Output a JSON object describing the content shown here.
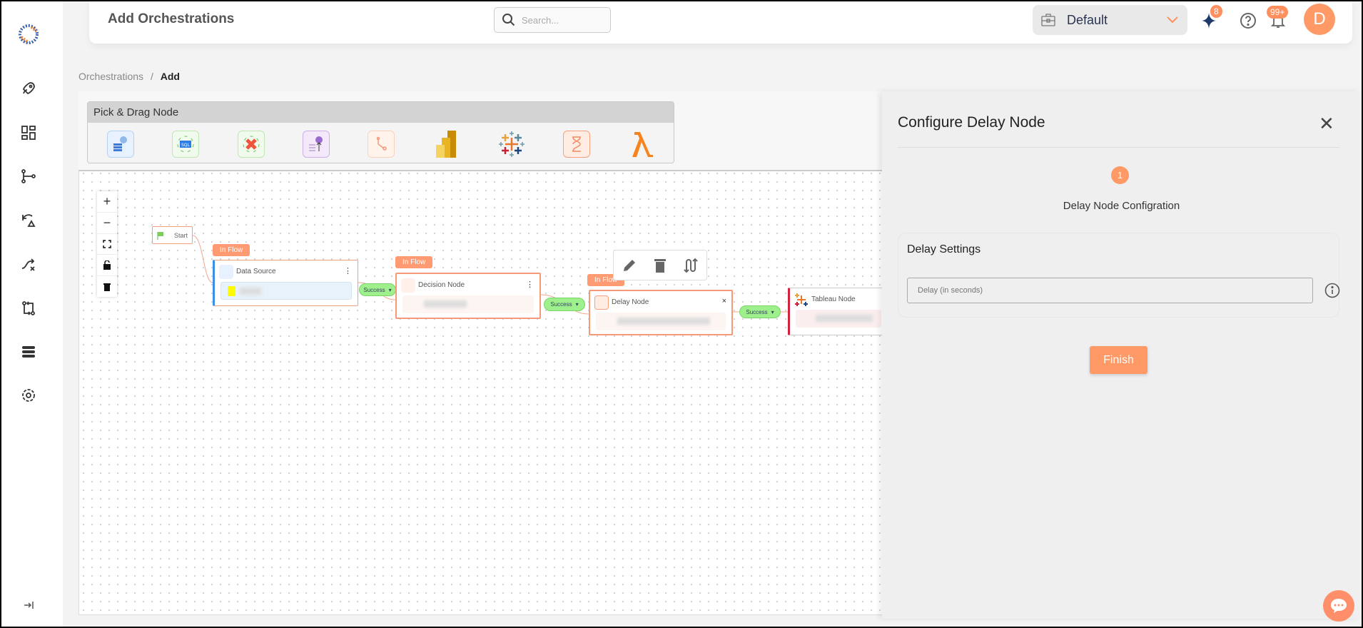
{
  "header": {
    "title": "Add Orchestrations",
    "search_placeholder": "Search...",
    "workspace": "Default",
    "ai_badge": "8",
    "notif_badge": "99+",
    "avatar_initial": "D"
  },
  "breadcrumb": {
    "parent": "Orchestrations",
    "separator": "/",
    "current": "Add"
  },
  "sidebar": {
    "items": [
      "logo",
      "rocket-icon",
      "dashboard-icon",
      "pipeline-icon",
      "refresh-alert-icon",
      "shuffle-icon",
      "transfer-icon",
      "database-icon",
      "gear-icon"
    ],
    "collapse": "collapse-icon"
  },
  "palette": {
    "title": "Pick & Drag Node",
    "items": [
      "data-source-icon",
      "sql-icon",
      "transform-icon",
      "cloud-upload-icon",
      "decision-icon",
      "power-bi-icon",
      "tableau-icon",
      "delay-icon",
      "lambda-icon"
    ]
  },
  "flow": {
    "start": "Start",
    "in_flow": "In Flow",
    "success": "Success",
    "nodes": [
      {
        "title": "Data Source"
      },
      {
        "title": "Decision Node"
      },
      {
        "title": "Delay Node"
      },
      {
        "title": "Tableau Node"
      }
    ]
  },
  "panel": {
    "title": "Configure Delay Node",
    "step_number": "1",
    "step_label": "Delay Node Configration",
    "section": "Delay Settings",
    "delay_placeholder": "Delay (in seconds)",
    "delay_value": "",
    "finish": "Finish"
  },
  "colors": {
    "accent": "#ff9966",
    "success": "#9ef08c",
    "tableau_red": "#d0243f"
  }
}
